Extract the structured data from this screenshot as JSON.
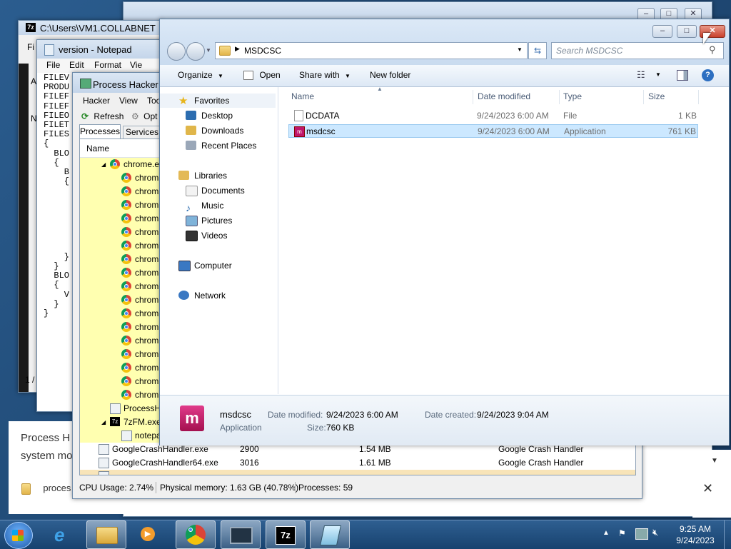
{
  "sevenzip": {
    "title": "C:\\Users\\VM1.COLLABNET",
    "menu_first": "Fi",
    "left_chars": [
      "A",
      "N"
    ],
    "status": "1 /"
  },
  "notepad": {
    "title": "version - Notepad",
    "menu": [
      "File",
      "Edit",
      "Format",
      "Vie"
    ],
    "lines": [
      "FILEV",
      "PRODU",
      "FILEF",
      "FILEF",
      "FILEO",
      "FILET",
      "FILES",
      "{",
      "  BLO",
      "  {",
      "    B",
      "    {",
      "",
      "",
      "",
      "",
      "",
      "",
      "",
      "    }",
      "  }",
      "  BLO",
      "  {",
      "    V",
      "  }",
      "}"
    ]
  },
  "process_hacker": {
    "title": "Process Hacker [C",
    "menu": [
      "Hacker",
      "View",
      "Too"
    ],
    "toolbar": {
      "refresh": "Refresh",
      "options": "Opt"
    },
    "tabs": [
      "Processes",
      "Services"
    ],
    "name_header": "Name",
    "chrome_parent": "chrome.ex",
    "chrome_child_label": "chrom",
    "chrome_child_count": 17,
    "other_rows": [
      "ProcessHa",
      "7zFM.exe",
      "notepa"
    ],
    "crash_rows": [
      {
        "name": "GoogleCrashHandler.exe",
        "pid": "2900",
        "mem": "1.54 MB",
        "desc": "Google Crash Handler"
      },
      {
        "name": "GoogleCrashHandler64.exe",
        "pid": "3016",
        "mem": "1.61 MB",
        "desc": "Google Crash Handler"
      }
    ],
    "status": {
      "cpu": "CPU Usage: 2.74%",
      "physical": "Physical memory: 1.63 GB (40.78%)",
      "processes": "Processes: 59"
    }
  },
  "background_text": {
    "line1": "Process H",
    "line2": "system mo",
    "download_label": "proces"
  },
  "explorer": {
    "address": "MSDCSC",
    "search_placeholder": "Search MSDCSC",
    "toolbar": {
      "organize": "Organize",
      "open": "Open",
      "share_with": "Share with",
      "new_folder": "New folder"
    },
    "nav": {
      "favorites": "Favorites",
      "desktop": "Desktop",
      "downloads": "Downloads",
      "recent_places": "Recent Places",
      "libraries": "Libraries",
      "documents": "Documents",
      "music": "Music",
      "pictures": "Pictures",
      "videos": "Videos",
      "computer": "Computer",
      "network": "Network"
    },
    "columns": {
      "name": "Name",
      "date": "Date modified",
      "type": "Type",
      "size": "Size"
    },
    "files": [
      {
        "name": "DCDATA",
        "date": "9/24/2023 6:00 AM",
        "type": "File",
        "size": "1 KB"
      },
      {
        "name": "msdcsc",
        "date": "9/24/2023 6:00 AM",
        "type": "Application",
        "size": "761 KB"
      }
    ],
    "details": {
      "name": "msdcsc",
      "kind": "Application",
      "date_modified_label": "Date modified:",
      "date_modified": "9/24/2023 6:00 AM",
      "date_created_label": "Date created:",
      "date_created": "9/24/2023 9:04 AM",
      "size_label": "Size:",
      "size": "760 KB"
    }
  },
  "taskbar": {
    "clock_time": "9:25 AM",
    "clock_date": "9/24/2023",
    "sevenzip_label": "7z"
  },
  "colors": {
    "selection": "#cce8ff",
    "process_yellow": "#ffffb0",
    "taskbar": "#1c4a78"
  }
}
